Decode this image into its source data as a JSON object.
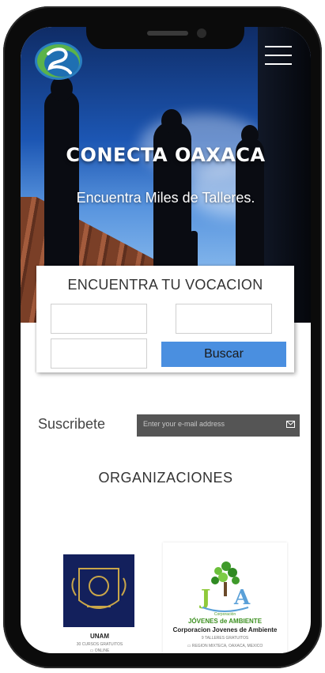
{
  "hero": {
    "title": "CONECTA OAXACA",
    "subtitle": "Encuentra Miles de Talleres."
  },
  "search": {
    "title": "ENCUENTRA TU VOCACION",
    "button_label": "Buscar",
    "field1_value": "",
    "field2_value": "",
    "field3_value": ""
  },
  "subscribe": {
    "label": "Suscribete",
    "placeholder": "Enter your e-mail address"
  },
  "organizations": {
    "title": "ORGANIZACIONES",
    "items": [
      {
        "name": "UNAM",
        "meta": "30 CURSOS GRATUITOS",
        "location": "ONLINE"
      },
      {
        "name": "Corporacion Jovenes de Ambiente",
        "meta": "9 TALLERES GRATUITOS",
        "location": "REGION MIXTECA, OAXACA, MEXICO",
        "logo_small": "Corporación",
        "logo_big": "JÓVENES de AMBIENTE"
      }
    ]
  },
  "colors": {
    "accent": "#4a8fe0",
    "subscribe_bg": "#555555",
    "unam_blue": "#13205c"
  },
  "icons": [
    "logo-icon",
    "hamburger-menu-icon",
    "mail-icon",
    "location-icon"
  ]
}
